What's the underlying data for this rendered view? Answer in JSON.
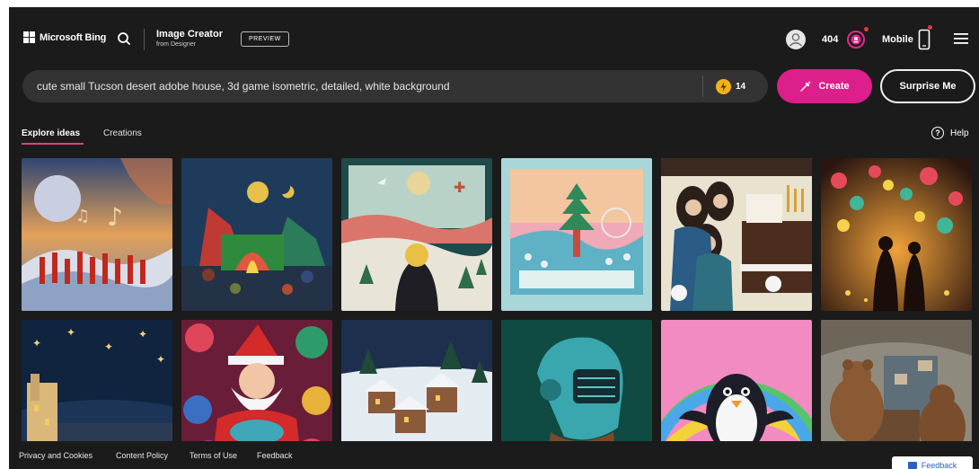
{
  "header": {
    "brand": "Microsoft Bing",
    "app_title": "Image Creator",
    "app_subtitle": "from Designer",
    "preview_badge": "PREVIEW",
    "points": "404",
    "mobile_label": "Mobile"
  },
  "prompt": {
    "value": "cute small Tucson desert adobe house, 3d game isometric, detailed, white background",
    "boosts": "14",
    "create_label": "Create",
    "surprise_label": "Surprise Me"
  },
  "tabs": [
    {
      "label": "Explore ideas",
      "active": true
    },
    {
      "label": "Creations",
      "active": false
    }
  ],
  "help_label": "Help",
  "gallery": [
    {
      "subject": "music-clouds"
    },
    {
      "subject": "campfire-village"
    },
    {
      "subject": "moon-hill-traveler"
    },
    {
      "subject": "paper-pagoda-park"
    },
    {
      "subject": "piano-women-cats"
    },
    {
      "subject": "lantern-festival"
    },
    {
      "subject": "starry-village"
    },
    {
      "subject": "santa-ornaments"
    },
    {
      "subject": "snowy-town"
    },
    {
      "subject": "robot-helmet"
    },
    {
      "subject": "rainbow-penguin"
    },
    {
      "subject": "bears-cabin"
    }
  ],
  "footer": {
    "links": [
      "Privacy and Cookies",
      "Content Policy",
      "Terms of Use",
      "Feedback"
    ],
    "feedback_button": "Feedback"
  },
  "colors": {
    "background": "#1b1b1b",
    "accent": "#dc1f8a",
    "prompt_bar": "#333333",
    "boost_coin": "#f3b21a"
  }
}
